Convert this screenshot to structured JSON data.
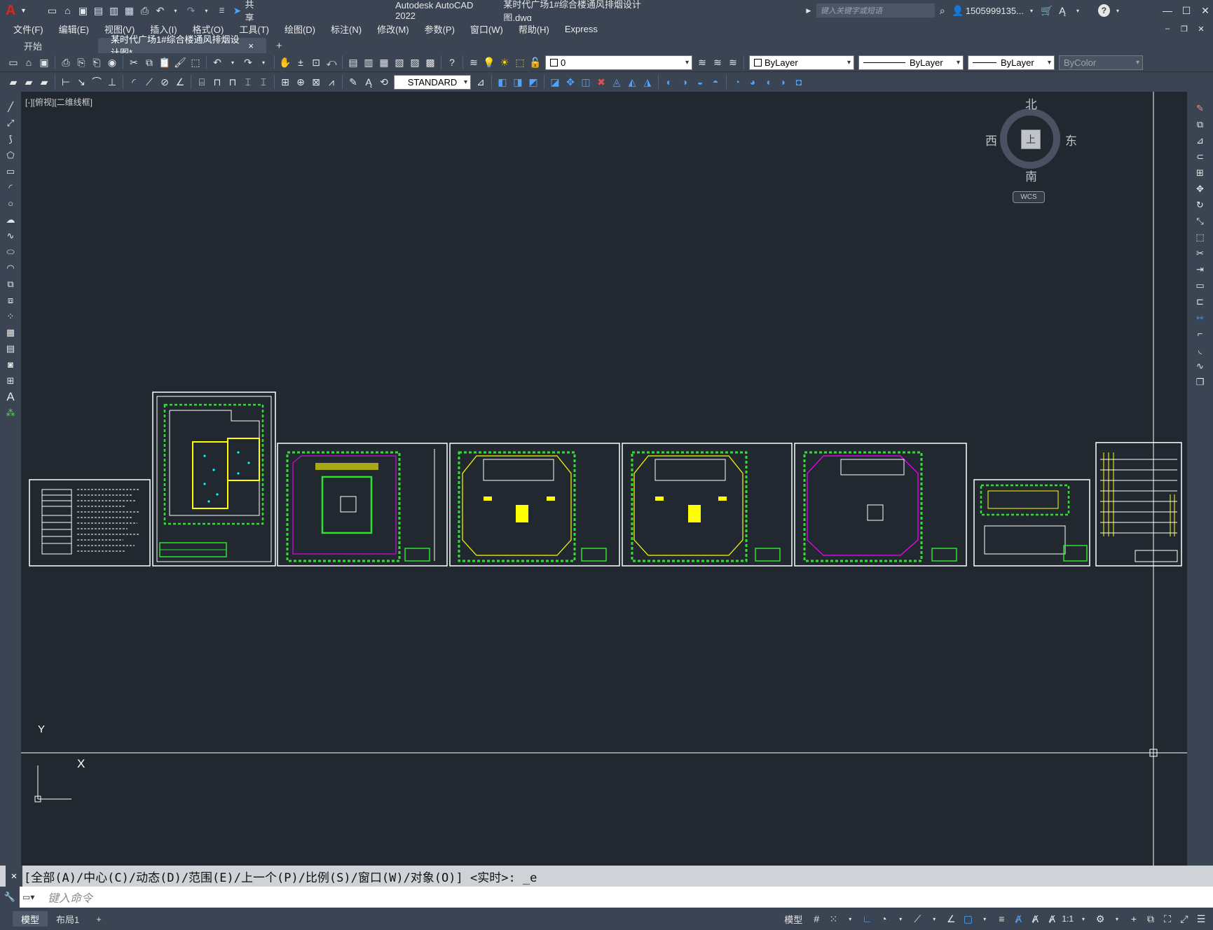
{
  "title": {
    "app": "Autodesk AutoCAD 2022",
    "file": "某时代广场1#综合楼通风排烟设计图.dwg",
    "share": "共享",
    "search_placeholder": "键入关键字或短语",
    "user": "1505999135...",
    "help": "?"
  },
  "menus": [
    "文件(F)",
    "编辑(E)",
    "视图(V)",
    "插入(I)",
    "格式(O)",
    "工具(T)",
    "绘图(D)",
    "标注(N)",
    "修改(M)",
    "参数(P)",
    "窗口(W)",
    "帮助(H)",
    "Express"
  ],
  "tabs": {
    "start": "开始",
    "active": "某时代广场1#综合楼通风排烟设计图*",
    "close": "×",
    "add": "+"
  },
  "props": {
    "layer": "0",
    "color": "ByLayer",
    "linetype": "ByLayer",
    "lineweight": "ByLayer",
    "plotstyle": "ByColor",
    "textstyle": "STANDARD"
  },
  "viewport_label": "[-][俯视][二维线框]",
  "viewcube": {
    "north": "北",
    "south": "南",
    "east": "东",
    "west": "西",
    "top": "上",
    "wcs": "WCS"
  },
  "ucs": {
    "x": "X",
    "y": "Y"
  },
  "command": {
    "history": "[全部(A)/中心(C)/动态(D)/范围(E)/上一个(P)/比例(S)/窗口(W)/对象(O)] <实时>: _e",
    "placeholder": "键入命令"
  },
  "status": {
    "model_tab": "模型",
    "layout_tab": "布局1",
    "add": "+",
    "model_btn": "模型",
    "scale": "1:1"
  },
  "colors": {
    "background": "#212830",
    "ui": "#3b4453",
    "cad_green": "#2fe02f",
    "cad_yellow": "#ffff00",
    "cad_cyan": "#00ffff",
    "cad_magenta": "#ff00ff",
    "cad_white": "#ffffff"
  }
}
